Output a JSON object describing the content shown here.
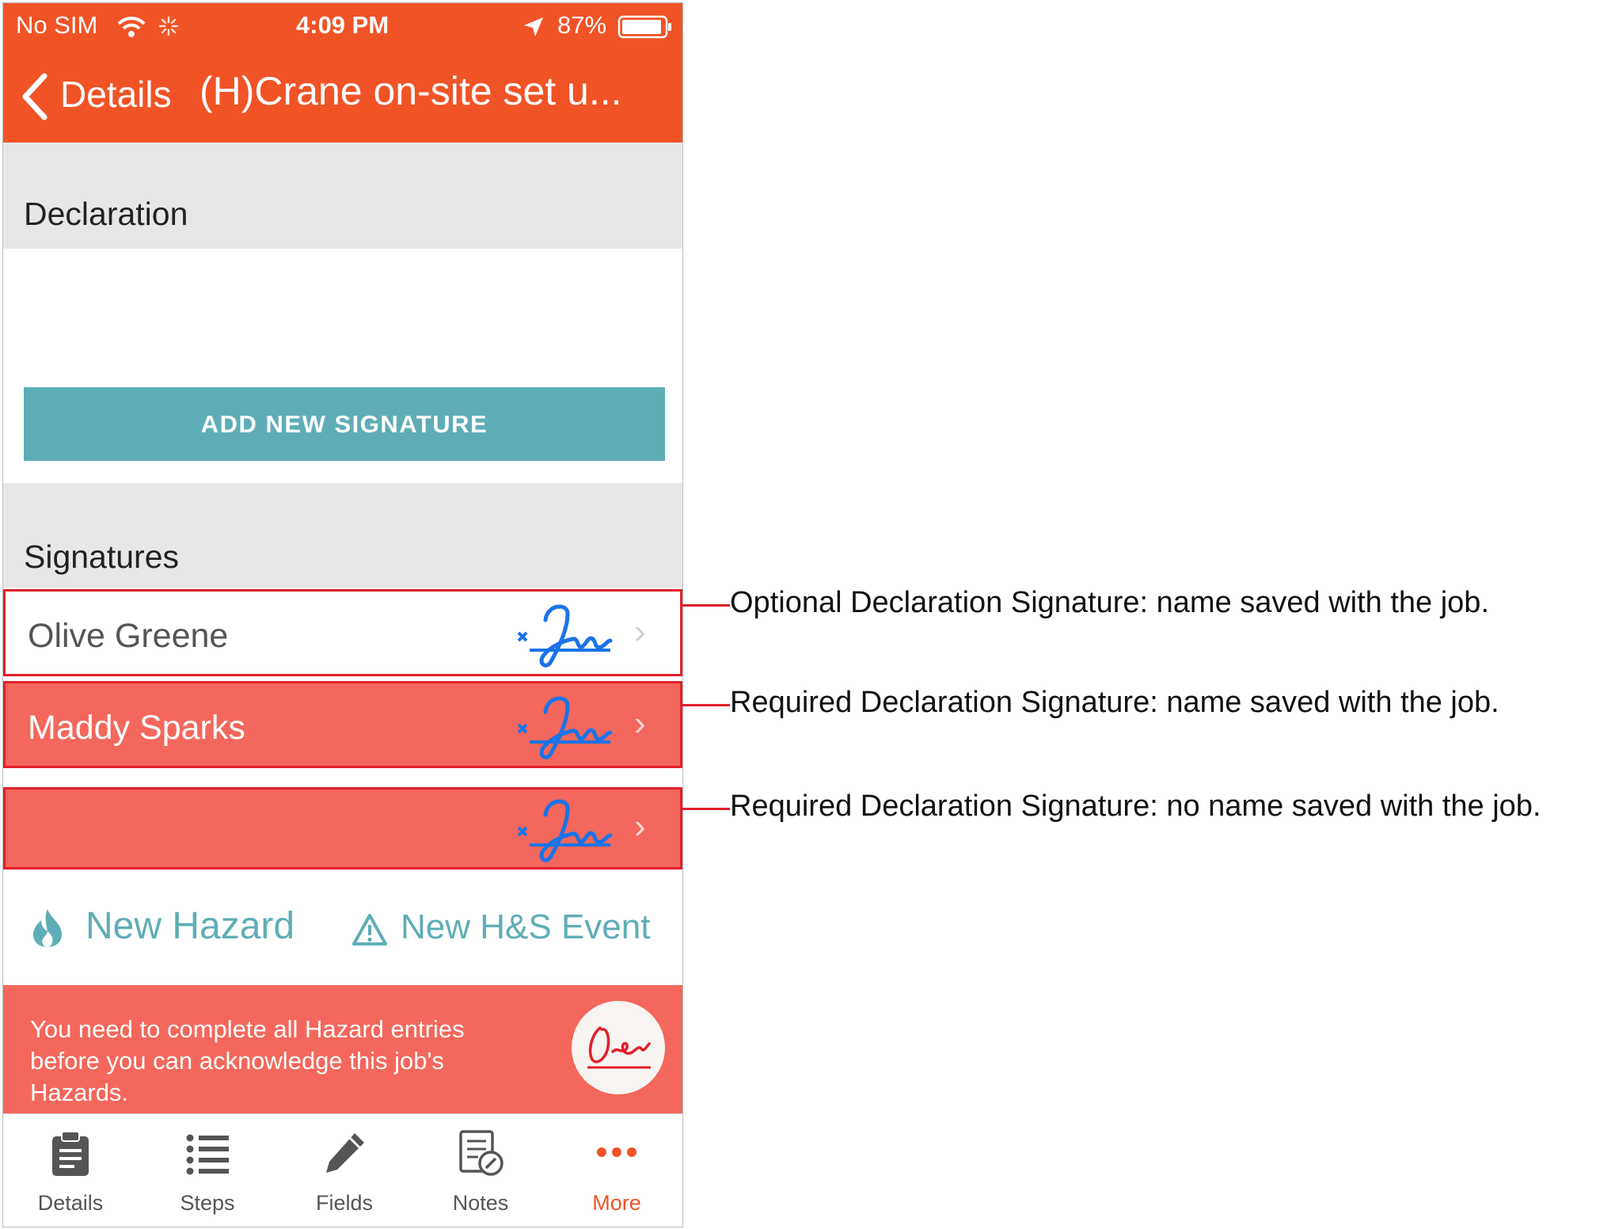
{
  "status_bar": {
    "carrier": "No SIM",
    "time": "4:09 PM",
    "battery": "87%",
    "icons": [
      "wifi-icon",
      "activity-spinner-icon",
      "location-arrow-icon",
      "battery-icon"
    ]
  },
  "nav": {
    "back_label": "Details",
    "title": "(H)Crane on-site set u..."
  },
  "declaration": {
    "title": "Declaration",
    "add_button": "ADD NEW SIGNATURE"
  },
  "signatures": {
    "title": "Signatures",
    "rows": [
      {
        "name": "Olive Greene",
        "required": false
      },
      {
        "name": "Maddy Sparks",
        "required": true
      },
      {
        "name": "",
        "required": true
      }
    ]
  },
  "quick_actions": {
    "new_hazard": "New Hazard",
    "new_event": "New H&S Event"
  },
  "banner": {
    "text": "You need to complete all Hazard entries before you can acknowledge this job's Hazards."
  },
  "tabs": [
    {
      "label": "Details",
      "icon": "clipboard-icon"
    },
    {
      "label": "Steps",
      "icon": "list-icon"
    },
    {
      "label": "Fields",
      "icon": "pencil-icon"
    },
    {
      "label": "Notes",
      "icon": "notes-icon"
    },
    {
      "label": "More",
      "icon": "more-dots-icon",
      "active": true
    }
  ],
  "annotations": [
    "Optional Declaration Signature: name saved with the job.",
    "Required Declaration Signature: name saved with the job.",
    "Required Declaration Signature: no name saved with the job."
  ],
  "colors": {
    "header": "#f05326",
    "teal": "#5fadb6",
    "required_row": "#f4675c",
    "signature_blue": "#1a73e8",
    "annotation_red": "#e0202a"
  }
}
